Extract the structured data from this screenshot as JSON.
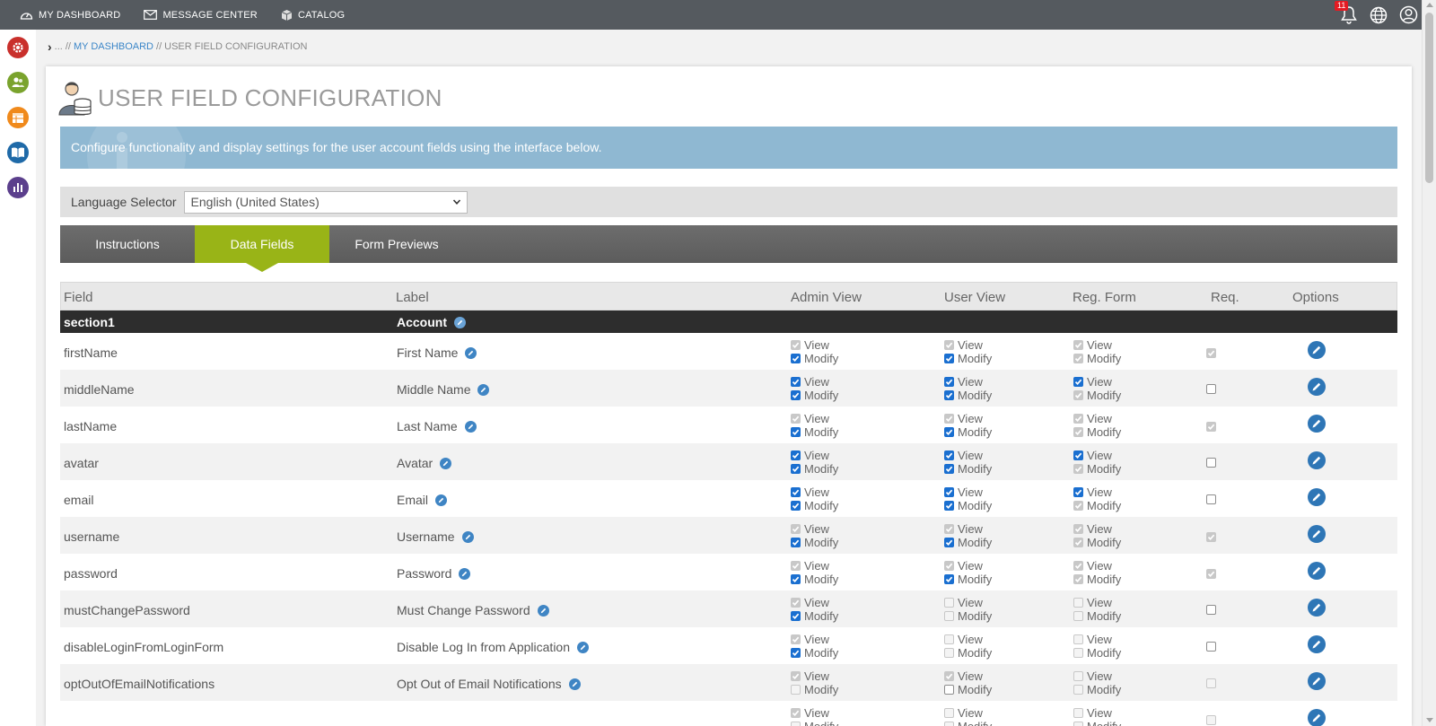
{
  "topnav": [
    {
      "label": "MY DASHBOARD",
      "icon": "dashboard-gauge-icon"
    },
    {
      "label": "MESSAGE CENTER",
      "icon": "envelope-icon"
    },
    {
      "label": "CATALOG",
      "icon": "box-icon"
    }
  ],
  "notifications": {
    "count": "11"
  },
  "breadcrumb": {
    "ellipsis": "...",
    "sep1": "//",
    "link": "MY DASHBOARD",
    "sep2": "//",
    "current": "USER FIELD CONFIGURATION"
  },
  "page": {
    "title": "USER FIELD CONFIGURATION",
    "info": "Configure functionality and display settings for the user account fields using the interface below."
  },
  "language": {
    "label": "Language Selector",
    "selected": "English (United States)"
  },
  "tabs": [
    {
      "label": "Instructions",
      "active": false
    },
    {
      "label": "Data Fields",
      "active": true
    },
    {
      "label": "Form Previews",
      "active": false
    }
  ],
  "grid": {
    "headers": {
      "field": "Field",
      "label": "Label",
      "admin_view": "Admin View",
      "user_view": "User View",
      "reg_form": "Reg. Form",
      "req": "Req.",
      "options": "Options"
    },
    "section": {
      "name": "section1",
      "label": "Account"
    },
    "view_text": "View",
    "modify_text": "Modify",
    "rows": [
      {
        "field": "firstName",
        "label": "First Name",
        "admin": {
          "view": {
            "checked": true,
            "disabled": true
          },
          "modify": {
            "checked": true,
            "disabled": false
          }
        },
        "user": {
          "view": {
            "checked": true,
            "disabled": true
          },
          "modify": {
            "checked": true,
            "disabled": false
          }
        },
        "reg": {
          "view": {
            "checked": true,
            "disabled": true
          },
          "modify": {
            "checked": true,
            "disabled": true
          }
        },
        "req": {
          "checked": true,
          "disabled": true
        }
      },
      {
        "field": "middleName",
        "label": "Middle Name",
        "admin": {
          "view": {
            "checked": true,
            "disabled": false
          },
          "modify": {
            "checked": true,
            "disabled": false
          }
        },
        "user": {
          "view": {
            "checked": true,
            "disabled": false
          },
          "modify": {
            "checked": true,
            "disabled": false
          }
        },
        "reg": {
          "view": {
            "checked": true,
            "disabled": false
          },
          "modify": {
            "checked": true,
            "disabled": true
          }
        },
        "req": {
          "checked": false,
          "disabled": false
        }
      },
      {
        "field": "lastName",
        "label": "Last Name",
        "admin": {
          "view": {
            "checked": true,
            "disabled": true
          },
          "modify": {
            "checked": true,
            "disabled": false
          }
        },
        "user": {
          "view": {
            "checked": true,
            "disabled": true
          },
          "modify": {
            "checked": true,
            "disabled": false
          }
        },
        "reg": {
          "view": {
            "checked": true,
            "disabled": true
          },
          "modify": {
            "checked": true,
            "disabled": true
          }
        },
        "req": {
          "checked": true,
          "disabled": true
        }
      },
      {
        "field": "avatar",
        "label": "Avatar",
        "admin": {
          "view": {
            "checked": true,
            "disabled": false
          },
          "modify": {
            "checked": true,
            "disabled": false
          }
        },
        "user": {
          "view": {
            "checked": true,
            "disabled": false
          },
          "modify": {
            "checked": true,
            "disabled": false
          }
        },
        "reg": {
          "view": {
            "checked": true,
            "disabled": false
          },
          "modify": {
            "checked": true,
            "disabled": true
          }
        },
        "req": {
          "checked": false,
          "disabled": false
        }
      },
      {
        "field": "email",
        "label": "Email",
        "admin": {
          "view": {
            "checked": true,
            "disabled": false
          },
          "modify": {
            "checked": true,
            "disabled": false
          }
        },
        "user": {
          "view": {
            "checked": true,
            "disabled": false
          },
          "modify": {
            "checked": true,
            "disabled": false
          }
        },
        "reg": {
          "view": {
            "checked": true,
            "disabled": false
          },
          "modify": {
            "checked": true,
            "disabled": true
          }
        },
        "req": {
          "checked": false,
          "disabled": false
        }
      },
      {
        "field": "username",
        "label": "Username",
        "admin": {
          "view": {
            "checked": true,
            "disabled": true
          },
          "modify": {
            "checked": true,
            "disabled": false
          }
        },
        "user": {
          "view": {
            "checked": true,
            "disabled": true
          },
          "modify": {
            "checked": true,
            "disabled": false
          }
        },
        "reg": {
          "view": {
            "checked": true,
            "disabled": true
          },
          "modify": {
            "checked": true,
            "disabled": true
          }
        },
        "req": {
          "checked": true,
          "disabled": true
        }
      },
      {
        "field": "password",
        "label": "Password",
        "admin": {
          "view": {
            "checked": true,
            "disabled": true
          },
          "modify": {
            "checked": true,
            "disabled": false
          }
        },
        "user": {
          "view": {
            "checked": true,
            "disabled": true
          },
          "modify": {
            "checked": true,
            "disabled": false
          }
        },
        "reg": {
          "view": {
            "checked": true,
            "disabled": true
          },
          "modify": {
            "checked": true,
            "disabled": true
          }
        },
        "req": {
          "checked": true,
          "disabled": true
        }
      },
      {
        "field": "mustChangePassword",
        "label": "Must Change Password",
        "admin": {
          "view": {
            "checked": true,
            "disabled": true
          },
          "modify": {
            "checked": true,
            "disabled": false
          }
        },
        "user": {
          "view": {
            "checked": false,
            "disabled": true
          },
          "modify": {
            "checked": false,
            "disabled": true
          }
        },
        "reg": {
          "view": {
            "checked": false,
            "disabled": true
          },
          "modify": {
            "checked": false,
            "disabled": true
          }
        },
        "req": {
          "checked": false,
          "disabled": false
        }
      },
      {
        "field": "disableLoginFromLoginForm",
        "label": "Disable Log In from Application",
        "admin": {
          "view": {
            "checked": true,
            "disabled": true
          },
          "modify": {
            "checked": true,
            "disabled": false
          }
        },
        "user": {
          "view": {
            "checked": false,
            "disabled": true
          },
          "modify": {
            "checked": false,
            "disabled": true
          }
        },
        "reg": {
          "view": {
            "checked": false,
            "disabled": true
          },
          "modify": {
            "checked": false,
            "disabled": true
          }
        },
        "req": {
          "checked": false,
          "disabled": false
        }
      },
      {
        "field": "optOutOfEmailNotifications",
        "label": "Opt Out of Email Notifications",
        "admin": {
          "view": {
            "checked": true,
            "disabled": true
          },
          "modify": {
            "checked": false,
            "disabled": true
          }
        },
        "user": {
          "view": {
            "checked": true,
            "disabled": true
          },
          "modify": {
            "checked": false,
            "disabled": false
          }
        },
        "reg": {
          "view": {
            "checked": false,
            "disabled": true
          },
          "modify": {
            "checked": false,
            "disabled": true
          }
        },
        "req": {
          "checked": false,
          "disabled": true
        }
      },
      {
        "field": "",
        "label": "",
        "admin": {
          "view": {
            "checked": true,
            "disabled": true
          },
          "modify": {
            "checked": false,
            "disabled": true
          }
        },
        "user": {
          "view": {
            "checked": false,
            "disabled": true
          },
          "modify": {
            "checked": false,
            "disabled": true
          }
        },
        "reg": {
          "view": {
            "checked": false,
            "disabled": true
          },
          "modify": {
            "checked": false,
            "disabled": true
          }
        },
        "req": {
          "checked": false,
          "disabled": true
        }
      }
    ]
  },
  "colors": {
    "topbar": "#555a5f",
    "accent_green": "#99b417",
    "info_blue": "#8fb8d2",
    "checkbox_blue": "#1a6fd0",
    "edit_icon_blue": "#2e76b6"
  },
  "sidebar_icons": [
    "gear-settings-icon",
    "users-icon",
    "calendar-icon",
    "book-icon",
    "bar-chart-icon"
  ]
}
